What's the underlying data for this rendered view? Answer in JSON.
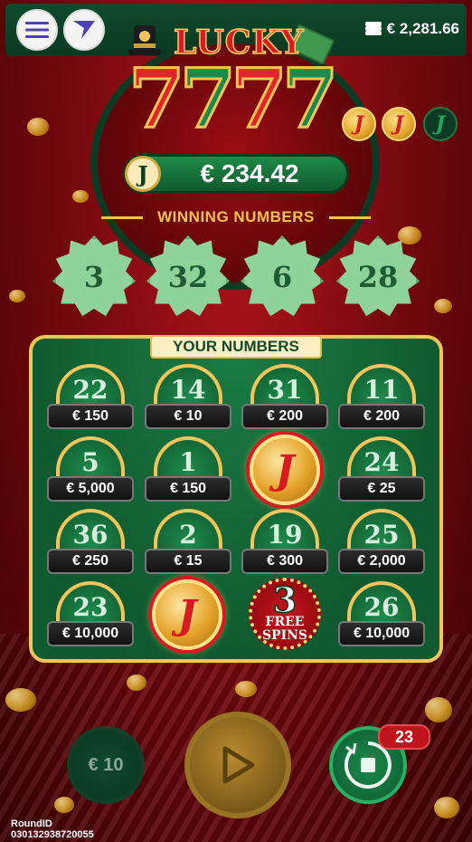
{
  "header": {
    "menu_icon": "hamburger-icon",
    "brand_icon": "chevron-logo-icon",
    "balance": "€ 2,281.66",
    "balance_icon": "coin-stack-icon"
  },
  "logo": {
    "top_text": "LUCKY",
    "digits": [
      "7",
      "7",
      "7",
      "7"
    ]
  },
  "jackpot_tokens": [
    {
      "label": "J",
      "collected": true
    },
    {
      "label": "J",
      "collected": true
    },
    {
      "label": "J",
      "collected": false
    }
  ],
  "prize": {
    "token_label": "J",
    "amount": "€ 234.42"
  },
  "winning_numbers": {
    "title": "WINNING NUMBERS",
    "numbers": [
      "3",
      "32",
      "6",
      "28"
    ]
  },
  "your_numbers": {
    "title": "YOUR NUMBERS",
    "cells": [
      {
        "number": "22",
        "prize": "€ 150"
      },
      {
        "number": "14",
        "prize": "€ 10"
      },
      {
        "number": "31",
        "prize": "€ 200"
      },
      {
        "number": "11",
        "prize": "€ 200"
      },
      {
        "number": "5",
        "prize": "€ 5,000"
      },
      {
        "number": "1",
        "prize": "€ 150"
      },
      {
        "special": "J"
      },
      {
        "number": "24",
        "prize": "€ 25"
      },
      {
        "number": "36",
        "prize": "€ 250"
      },
      {
        "number": "2",
        "prize": "€ 15"
      },
      {
        "number": "19",
        "prize": "€ 300"
      },
      {
        "number": "25",
        "prize": "€ 2,000"
      },
      {
        "number": "23",
        "prize": "€ 10,000"
      },
      {
        "special": "J"
      },
      {
        "free_spins": "3",
        "free_label_1": "FREE",
        "free_label_2": "SPINS"
      },
      {
        "number": "26",
        "prize": "€ 10,000"
      }
    ]
  },
  "controls": {
    "bet": "€ 10",
    "play_icon": "play-icon",
    "auto_icon": "stop-icon",
    "auto_count": "23"
  },
  "round": {
    "label": "RoundID",
    "id": "030132938720055"
  },
  "colors": {
    "background_red": "#7a0a0f",
    "board_green": "#0f5a30",
    "gold": "#f1c55a",
    "jackpot_red": "#d81b22"
  }
}
